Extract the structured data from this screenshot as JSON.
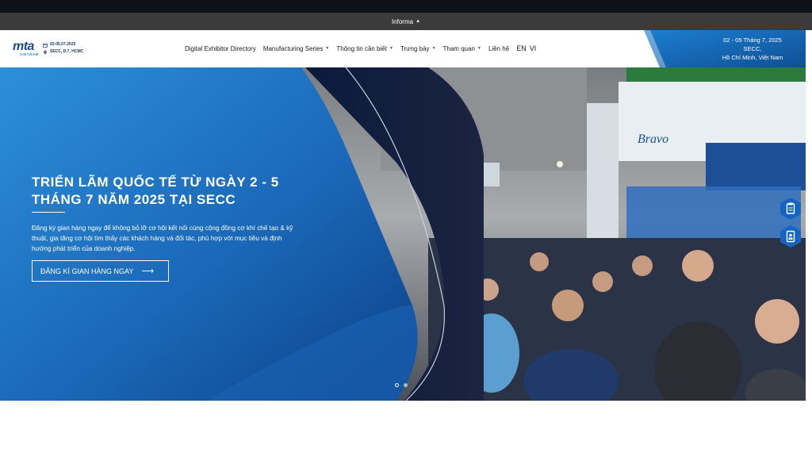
{
  "informa_bar": {
    "label": "Informa",
    "caret": "▲"
  },
  "logo": {
    "brand": "mta",
    "sub": "VIETNAM",
    "date": "02-05.07.2025",
    "venue": "SECC, D.7, HCMC"
  },
  "nav": {
    "items": [
      {
        "label": "Digital Exhibitor Directory",
        "has_dropdown": false
      },
      {
        "label": "Manufacturing Series",
        "has_dropdown": true
      },
      {
        "label": "Thông tin cần biết",
        "has_dropdown": true
      },
      {
        "label": "Trưng bày",
        "has_dropdown": true
      },
      {
        "label": "Tham quan",
        "has_dropdown": true
      },
      {
        "label": "Liên hệ",
        "has_dropdown": false
      }
    ],
    "lang_en": "EN",
    "lang_vi": "VI"
  },
  "header_right": {
    "line1": "02 - 05 Tháng 7, 2025",
    "line2": "SECC,",
    "line3": "Hồ Chí Minh, Việt Nam"
  },
  "hero": {
    "title": "TRIỂN LÃM QUỐC TẾ TỪ NGÀY 2 - 5 THÁNG 7 NĂM 2025 TẠI SECC",
    "description": "Đăng ký gian hàng ngay để không bỏ lỡ cơ hội kết nối cùng cộng đồng cơ khí chế tạo & kỹ thuật, gia tăng cơ hội tìm thấy các khách hàng và đối tác, phù hợp với mục tiêu và định hướng phát triển của doanh nghiệp.",
    "cta_label": "ĐĂNG KÍ GIAN HÀNG NGAY",
    "cta_arrow": "⟶",
    "booth_sign": "Bravo"
  },
  "carousel": {
    "slides": 2,
    "active": 1
  },
  "side_buttons": [
    "clipboard-icon",
    "badge-icon"
  ],
  "colors": {
    "brand_blue": "#1565b0",
    "navy": "#141a2e",
    "informa_bar": "#3b3b3b",
    "accent": "#1d8fd6"
  }
}
